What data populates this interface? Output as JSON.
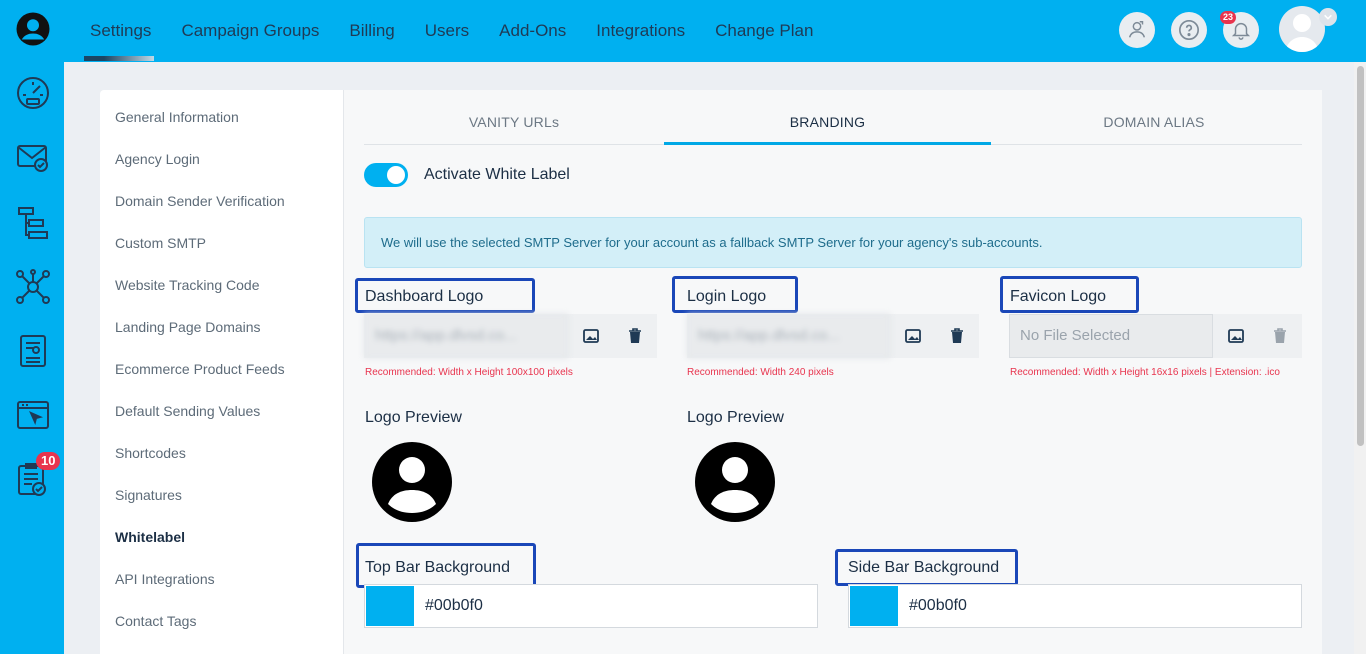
{
  "top_nav": {
    "items": [
      "Settings",
      "Campaign Groups",
      "Billing",
      "Users",
      "Add-Ons",
      "Integrations",
      "Change Plan"
    ],
    "notification_count": "23"
  },
  "sidebar_icons": {
    "badge_count": "10"
  },
  "left_menu": {
    "items": [
      "General Information",
      "Agency Login",
      "Domain Sender Verification",
      "Custom SMTP",
      "Website Tracking Code",
      "Landing Page Domains",
      "Ecommerce Product Feeds",
      "Default Sending Values",
      "Shortcodes",
      "Signatures",
      "Whitelabel",
      "API Integrations",
      "Contact Tags"
    ],
    "active": "Whitelabel"
  },
  "tabs": [
    "VANITY URLs",
    "BRANDING",
    "DOMAIN ALIAS"
  ],
  "active_tab": "BRANDING",
  "white_label": {
    "toggle_label": "Activate White Label",
    "enabled": true
  },
  "info_message": "We will use the selected SMTP Server for your account as a fallback SMTP Server for your agency's sub-accounts.",
  "logos": {
    "dashboard": {
      "label": "Dashboard Logo",
      "file": "https://app.dlvsd.co...",
      "recommendation": "Recommended: Width x Height 100x100 pixels"
    },
    "login": {
      "label": "Login Logo",
      "file": "https://app.dlvsd.co...",
      "recommendation": "Recommended: Width 240 pixels"
    },
    "favicon": {
      "label": "Favicon Logo",
      "file": "No File Selected",
      "recommendation": "Recommended: Width x Height 16x16 pixels | Extension: .ico"
    }
  },
  "preview": {
    "dashboard_label": "Logo Preview",
    "login_label": "Logo Preview"
  },
  "colors": {
    "top_bar": {
      "label": "Top Bar Background",
      "value": "#00b0f0"
    },
    "side_bar": {
      "label": "Side Bar Background",
      "value": "#00b0f0"
    }
  },
  "theme": {
    "accent": "#00b0f0",
    "highlight_box": "#1a47b8",
    "warning_text": "#e8344e"
  }
}
